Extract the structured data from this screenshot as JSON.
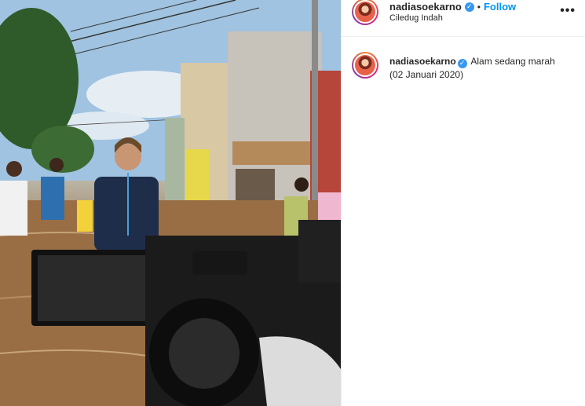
{
  "post": {
    "username": "nadiasoekarno",
    "verified_glyph": "✓",
    "separator": "•",
    "follow_label": "Follow",
    "location": "Ciledug Indah",
    "more_label": "•••"
  },
  "caption": {
    "username": "nadiasoekarno",
    "verified_glyph": "✓",
    "text_line1": "Alam sedang marah",
    "text_line2": "(02 Januari 2020)"
  },
  "icons": {
    "verified": "verified-badge-icon",
    "more": "more-options-icon"
  },
  "colors": {
    "follow": "#0095f6",
    "verified": "#3897f0",
    "text": "#262626"
  }
}
